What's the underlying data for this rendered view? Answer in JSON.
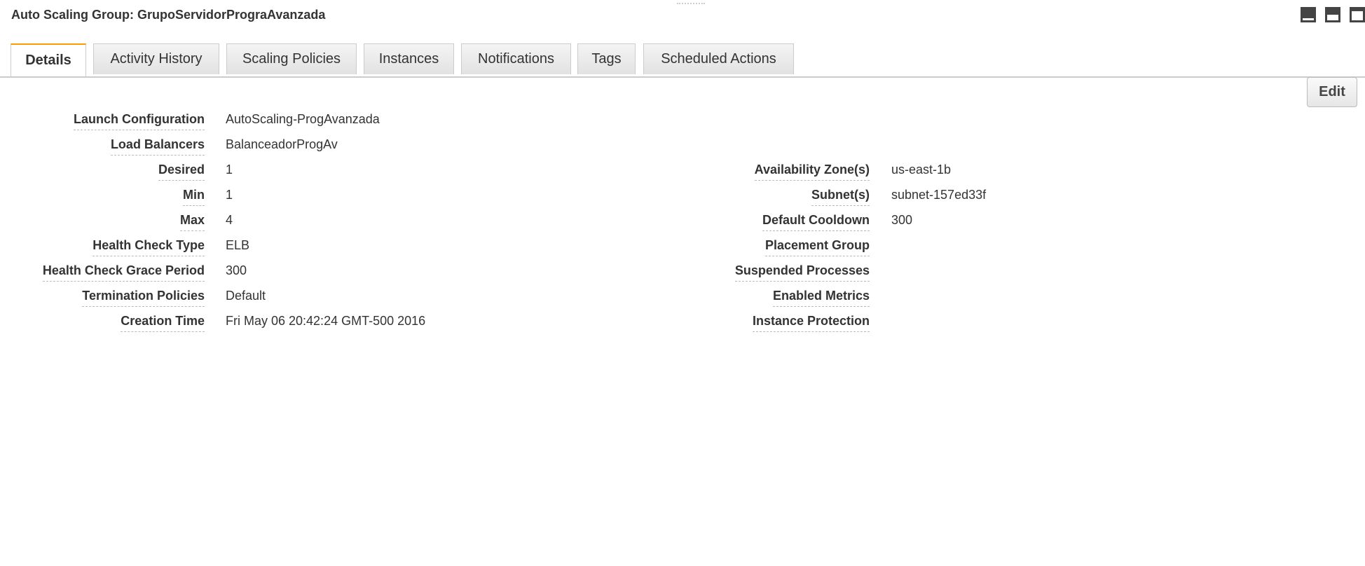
{
  "header": {
    "title": "Auto Scaling Group: GrupoServidorPrograAvanzada"
  },
  "tabs": [
    "Details",
    "Activity History",
    "Scaling Policies",
    "Instances",
    "Notifications",
    "Tags",
    "Scheduled Actions"
  ],
  "edit_label": "Edit",
  "left_fields": [
    {
      "label": "Launch Configuration",
      "value": "AutoScaling-ProgAvanzada"
    },
    {
      "label": "Load Balancers",
      "value": "BalanceadorProgAv"
    },
    {
      "label": "Desired",
      "value": "1"
    },
    {
      "label": "Min",
      "value": "1"
    },
    {
      "label": "Max",
      "value": "4"
    },
    {
      "label": "Health Check Type",
      "value": "ELB"
    },
    {
      "label": "Health Check Grace Period",
      "value": "300"
    },
    {
      "label": "Termination Policies",
      "value": "Default"
    },
    {
      "label": "Creation Time",
      "value": "Fri May 06 20:42:24 GMT-500 2016"
    }
  ],
  "right_fields": [
    {
      "label": "Availability Zone(s)",
      "value": "us-east-1b"
    },
    {
      "label": "Subnet(s)",
      "value": "subnet-157ed33f"
    },
    {
      "label": "Default Cooldown",
      "value": "300"
    },
    {
      "label": "Placement Group",
      "value": ""
    },
    {
      "label": "Suspended Processes",
      "value": ""
    },
    {
      "label": "Enabled Metrics",
      "value": ""
    },
    {
      "label": "Instance Protection",
      "value": ""
    }
  ]
}
